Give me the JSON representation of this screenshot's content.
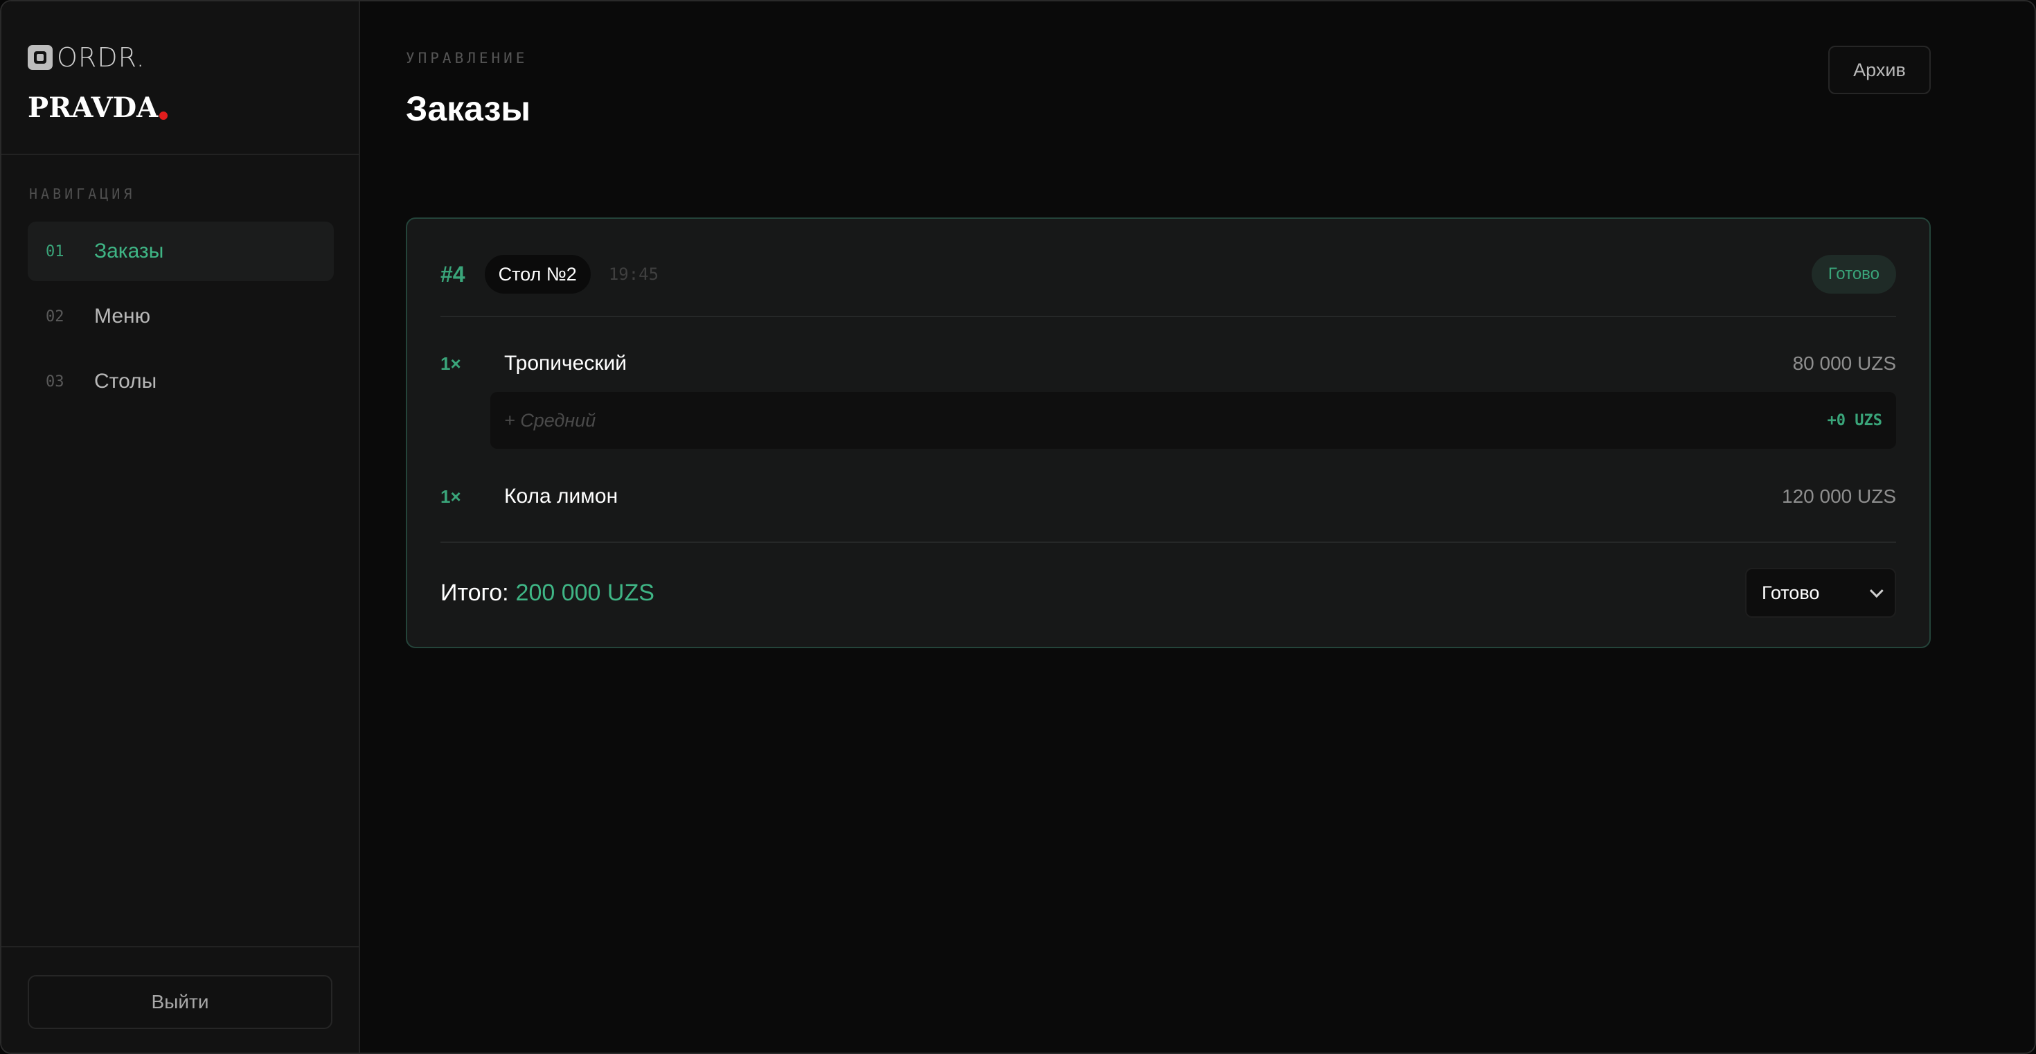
{
  "brand": {
    "product_name": "ORDR.",
    "venue_name": "PRAVDA",
    "accent_dot_color": "#e11d1d"
  },
  "sidebar": {
    "section_label": "НАВИГАЦИЯ",
    "items": [
      {
        "num": "01",
        "label": "Заказы",
        "active": true
      },
      {
        "num": "02",
        "label": "Меню",
        "active": false
      },
      {
        "num": "03",
        "label": "Столы",
        "active": false
      }
    ],
    "logout_label": "Выйти"
  },
  "header": {
    "eyebrow": "УПРАВЛЕНИЕ",
    "title": "Заказы",
    "archive_label": "Архив"
  },
  "order": {
    "number": "#4",
    "table": "Стол №2",
    "time": "19:45",
    "status": "Готово",
    "items": [
      {
        "qty": "1×",
        "name": "Тропический",
        "price": "80 000 UZS",
        "modifiers": [
          {
            "name": "+ Средний",
            "price": "+0 UZS"
          }
        ]
      },
      {
        "qty": "1×",
        "name": "Кола лимон",
        "price": "120 000 UZS"
      }
    ],
    "total_label": "Итого:",
    "total_value": "200 000 UZS",
    "status_select_value": "Готово"
  },
  "colors": {
    "accent_green": "#3aa57a",
    "background": "#0a0a0a",
    "card_border": "#24443a"
  }
}
